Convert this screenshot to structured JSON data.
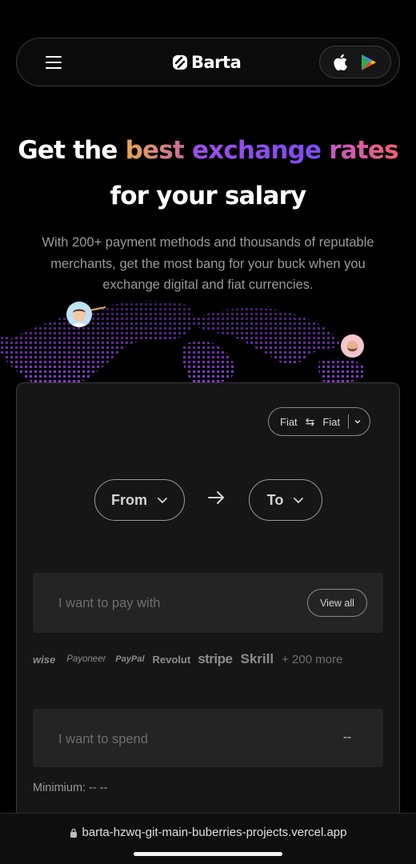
{
  "header": {
    "brand": "Barta",
    "menu_icon": "hamburger-menu-icon",
    "logo_icon": "barta-logo-icon",
    "store_icons": [
      "apple-icon",
      "google-play-icon"
    ]
  },
  "hero": {
    "title_line1_plain": "Get the ",
    "title_word_best": "best",
    "title_word_exchange": "exchange",
    "title_word_rates": "rates",
    "title_line2": "for your salary",
    "subtitle": "With 200+ payment methods and thousands of reputable merchants, get the most bang for your buck when you exchange digital and fiat currencies.",
    "colors": {
      "best": "#e8a752",
      "exchange": "#a24de8",
      "rates": "#f06070",
      "map_dots": "#8e3fe0"
    }
  },
  "exchange": {
    "mode_from": "Fiat",
    "mode_to": "Fiat",
    "from_label": "From",
    "to_label": "To",
    "pay_placeholder": "I want to pay with",
    "view_all_label": "View all",
    "providers": [
      "wise",
      "Payoneer",
      "PayPal",
      "Revolut",
      "stripe",
      "Skrill"
    ],
    "more_label": "+ 200 more",
    "spend_placeholder": "I want to spend",
    "spend_value": "--",
    "minimum_label": "Minimium: -- --"
  },
  "browser": {
    "url": "barta-hzwq-git-main-buberries-projects.vercel.app",
    "lock_icon": "lock-icon"
  }
}
